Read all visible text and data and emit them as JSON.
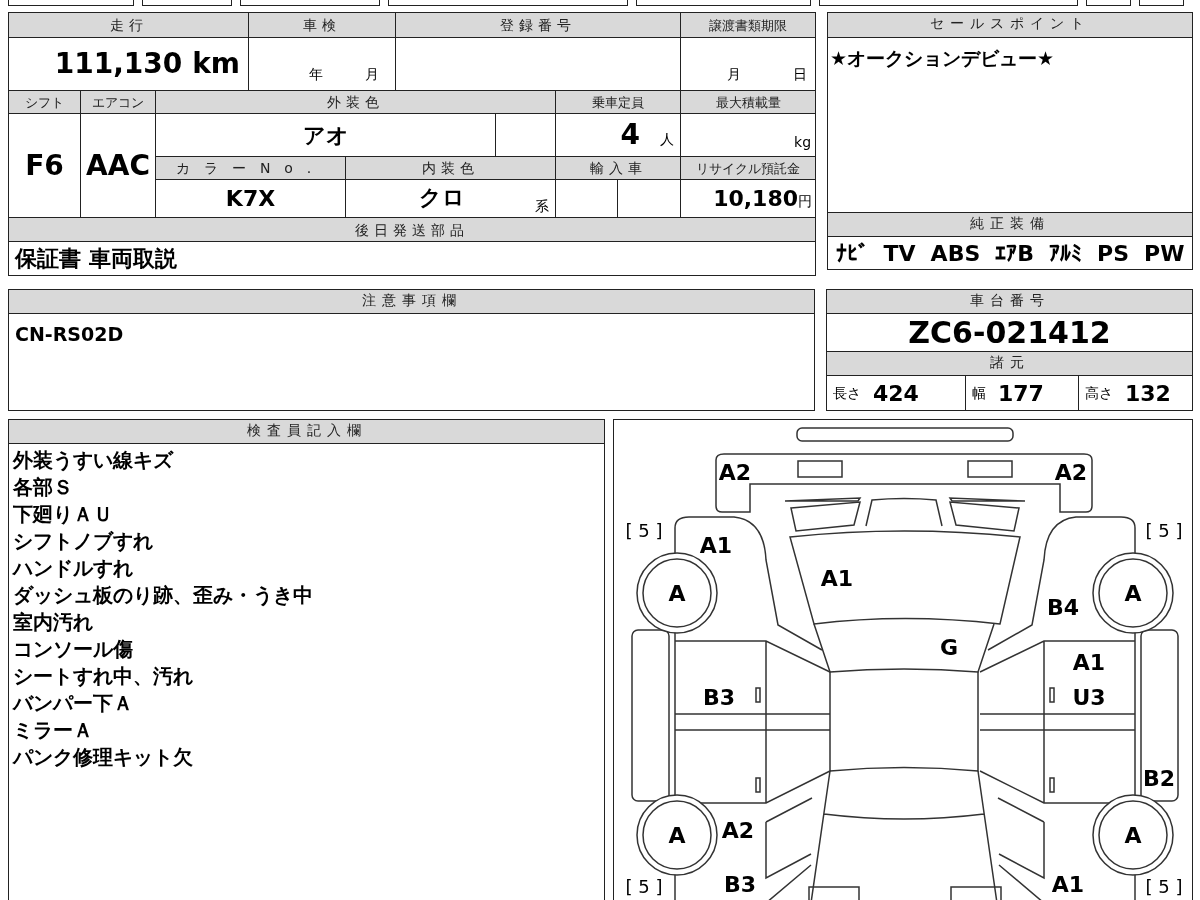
{
  "vehicle_info": {
    "mileage": {
      "label": "走行",
      "value": "111,130",
      "unit": "km"
    },
    "inspection": {
      "label": "車検",
      "year_unit": "年",
      "month_unit": "月"
    },
    "registration_number": {
      "label": "登録番号"
    },
    "transfer_deadline": {
      "label": "譲渡書類期限",
      "month_unit": "月",
      "day_unit": "日"
    },
    "shift": {
      "label": "シフト",
      "value": "F6"
    },
    "air_conditioner": {
      "label": "エアコン",
      "value": "AAC"
    },
    "exterior_color": {
      "label": "外装色",
      "value": "アオ"
    },
    "capacity": {
      "label": "乗車定員",
      "value": "4",
      "unit": "人"
    },
    "max_load": {
      "label": "最大積載量",
      "unit": "kg"
    },
    "color_number": {
      "label": "カラーNo.",
      "value": "K7X"
    },
    "interior_color": {
      "label": "内装色",
      "value": "クロ",
      "unit": "系"
    },
    "imported": {
      "label": "輸入車"
    },
    "recycle_fee": {
      "label": "リサイクル預託金",
      "value": "10,180",
      "unit": "円"
    }
  },
  "later_shipping_parts": {
    "label": "後日発送部品",
    "value": "保証書 車両取説"
  },
  "sales_point": {
    "label": "セールスポイント",
    "text": "★オークションデビュー★"
  },
  "standard_equipment": {
    "label": "純正装備",
    "items": [
      "ﾅﾋﾞ",
      "TV",
      "ABS",
      "ｴｱB",
      "ｱﾙﾐ",
      "PS",
      "PW"
    ]
  },
  "notes": {
    "label": "注意事項欄",
    "text": "CN-RS02D"
  },
  "chassis_number": {
    "label": "車台番号",
    "value": "ZC6-021412"
  },
  "specs": {
    "label": "諸元",
    "items": [
      {
        "label": "長さ",
        "value": "424"
      },
      {
        "label": "幅",
        "value": "177"
      },
      {
        "label": "高さ",
        "value": "132"
      }
    ]
  },
  "inspector_notes": {
    "label": "検査員記入欄",
    "lines": [
      "外装うすい線キズ",
      "各部Ｓ",
      "下廻りＡＵ",
      "シフトノブすれ",
      "ハンドルすれ",
      "ダッシュ板のり跡、歪み・うき中",
      "室内汚れ",
      "コンソール傷",
      "シートすれ中、汚れ",
      "バンパー下Ａ",
      "ミラーＡ",
      "パンク修理キット欠"
    ]
  },
  "damage_diagram": {
    "marks": {
      "front_bumper_left": "A2",
      "front_bumper_right": "A2",
      "front_fender_left": "A1",
      "hood": "A1",
      "front_fender_right": "B4",
      "windshield": "G",
      "front_door_right_upper": "A1",
      "front_door_right_lower": "U3",
      "front_door_left": "B3",
      "rocker_right": "B2",
      "rear_fender_left": "A2",
      "rear_bumper_left": "B3",
      "rear_bumper_right": "A1"
    },
    "tires": {
      "front_left": {
        "grade": "A",
        "tread": "[ 5 ]"
      },
      "front_right": {
        "grade": "A",
        "tread": "[ 5 ]"
      },
      "rear_left": {
        "grade": "A",
        "tread": "[ 5 ]"
      },
      "rear_right": {
        "grade": "A",
        "tread": "[ 5 ]"
      }
    }
  }
}
